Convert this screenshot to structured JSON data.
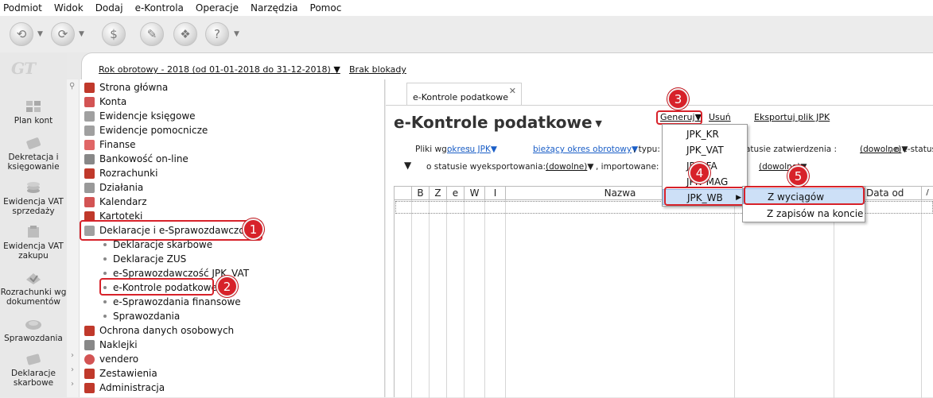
{
  "menubar": [
    "Podmiot",
    "Widok",
    "Dodaj",
    "e-Kontrola",
    "Operacje",
    "Narzędzia",
    "Pomoc"
  ],
  "logo": "GT",
  "leftnav": [
    {
      "label": "Plan kont",
      "icon": "chart-of-accounts-icon"
    },
    {
      "label": "Dekretacja i księgowanie",
      "icon": "posting-icon"
    },
    {
      "label": "Ewidencja VAT sprzedaży",
      "icon": "vat-sales-icon"
    },
    {
      "label": "Ewidencja VAT zakupu",
      "icon": "vat-purchase-icon"
    },
    {
      "label": "Rozrachunki wg dokumentów",
      "icon": "settlements-icon"
    },
    {
      "label": "Sprawozdania",
      "icon": "reports-icon"
    },
    {
      "label": "Deklaracje skarbowe",
      "icon": "tax-declarations-icon"
    }
  ],
  "infobar": {
    "fiscal_year": "Rok obrotowy - 2018  (od 01-01-2018 do 31-12-2018)",
    "lock": "Brak blokady"
  },
  "tree": {
    "items": [
      {
        "label": "Strona główna",
        "color": "#c0392b"
      },
      {
        "label": "Konta",
        "color": "#d35454"
      },
      {
        "label": "Ewidencje księgowe",
        "color": "#a0a0a0"
      },
      {
        "label": "Ewidencje pomocnicze",
        "color": "#a0a0a0"
      },
      {
        "label": "Finanse",
        "color": "#e06666"
      },
      {
        "label": "Bankowość on-line",
        "color": "#888888"
      },
      {
        "label": "Rozrachunki",
        "color": "#c0392b"
      },
      {
        "label": "Działania",
        "color": "#999999"
      },
      {
        "label": "Kalendarz",
        "color": "#d35454"
      },
      {
        "label": "Kartoteki",
        "color": "#c0392b"
      },
      {
        "label": "Deklaracje i e-Sprawozdawczość",
        "color": "#a0a0a0"
      }
    ],
    "subitems": [
      {
        "label": "Deklaracje skarbowe"
      },
      {
        "label": "Deklaracje ZUS"
      },
      {
        "label": "e-Sprawozdawczość JPK_VAT"
      },
      {
        "label": "e-Kontrole podatkowe"
      },
      {
        "label": "e-Sprawozdania finansowe"
      },
      {
        "label": "Sprawozdania"
      }
    ],
    "items_after": [
      {
        "label": "Ochrona danych osobowych",
        "color": "#c0392b"
      },
      {
        "label": "Naklejki",
        "color": "#888888"
      },
      {
        "label": "vendero",
        "color": "#d35454"
      },
      {
        "label": "Zestawienia",
        "color": "#c0392b"
      },
      {
        "label": "Administracja",
        "color": "#c0392b"
      }
    ]
  },
  "badges": [
    "1",
    "2",
    "3",
    "4",
    "5"
  ],
  "main": {
    "tab_label": "e-Kontrole podatkowe",
    "tab_close": "✕",
    "title": "e-Kontrole podatkowe",
    "actions": {
      "generate": "Generuj",
      "delete": "Usuń",
      "export": "Eksportuj plik JPK"
    },
    "filters": {
      "files_by": "Pliki wg:",
      "period": "okresu JPK",
      "current_period": "bieżący okres obrotowy",
      "type": ", typu:",
      "approval_status_suffix": "atusie zatwierdzenia :",
      "approval_value": "(dowolne)",
      "estatus": ", o e-status",
      "export_status": "o statusie wyeksportowania:",
      "export_value": "(dowolne)",
      "imported": ", importowane:",
      "imported_value": "(dowolne)"
    },
    "columns": [
      "B",
      "Z",
      "e",
      "W",
      "I",
      "Nazwa",
      "Data od",
      "/"
    ]
  },
  "generate_menu": [
    "JPK_KR",
    "JPK_VAT",
    "JPK_FA",
    "JPK_MAG",
    "JPK_WB"
  ],
  "wb_submenu": [
    "Z wyciągów",
    "Z zapisów na koncie"
  ],
  "colors": {
    "highlight": "#d7222a",
    "link_blue": "#1a5ec7",
    "menu_selected": "#cde0f7"
  }
}
